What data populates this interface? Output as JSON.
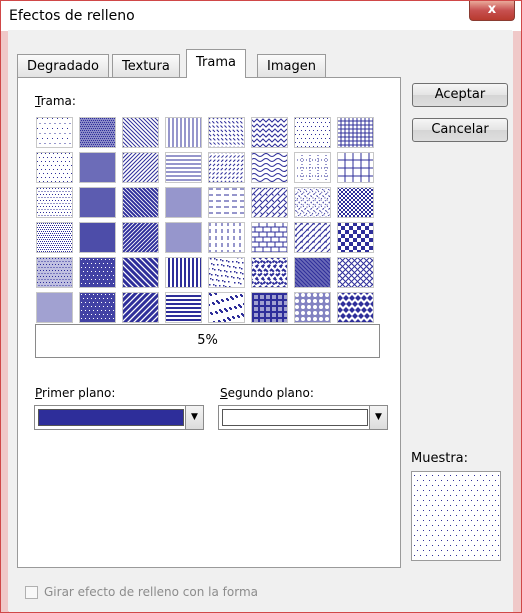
{
  "window": {
    "title": "Efectos de relleno",
    "close_glyph": "x"
  },
  "tabs": [
    {
      "label": "Degradado",
      "active": false
    },
    {
      "label": "Textura",
      "active": false
    },
    {
      "label": "Trama",
      "active": true
    },
    {
      "label": "Imagen",
      "active": false
    }
  ],
  "buttons": {
    "accept": "Aceptar",
    "cancel": "Cancelar"
  },
  "pattern_section": {
    "label": "Trama:",
    "selected_name": "5%"
  },
  "patterns": [
    "5%",
    "50%",
    "light-downward-diagonal",
    "light-vertical",
    "dashed-downward-diagonal",
    "zig-zag",
    "divot",
    "small-grid",
    "10%",
    "60%",
    "light-upward-diagonal",
    "light-horizontal",
    "dashed-upward-diagonal",
    "wave",
    "dotted-grid",
    "large-grid",
    "20%",
    "70%",
    "dark-downward-diagonal",
    "narrow-vertical",
    "dashed-horizontal",
    "diagonal-brick",
    "dotted-diamond",
    "small-checker-board",
    "25%",
    "75%",
    "dark-upward-diagonal",
    "narrow-horizontal",
    "dashed-vertical",
    "horizontal-brick",
    "shingle",
    "large-checker-board",
    "30%",
    "80%",
    "wide-downward-diagonal",
    "dark-vertical",
    "small-confetti",
    "weave",
    "trellis",
    "outlined-diamond",
    "40%",
    "90%",
    "wide-upward-diagonal",
    "dark-horizontal",
    "large-confetti",
    "plaid",
    "sphere",
    "solid-diamond"
  ],
  "pattern_color": "#2e2e9a",
  "foreground": {
    "label": "Primer plano:",
    "color": "#2e2e9a"
  },
  "background": {
    "label": "Segundo plano:",
    "color": "#ffffff"
  },
  "sample": {
    "label": "Muestra:"
  },
  "rotate_checkbox": {
    "label": "Girar efecto de relleno con la forma",
    "checked": false,
    "enabled": false
  }
}
